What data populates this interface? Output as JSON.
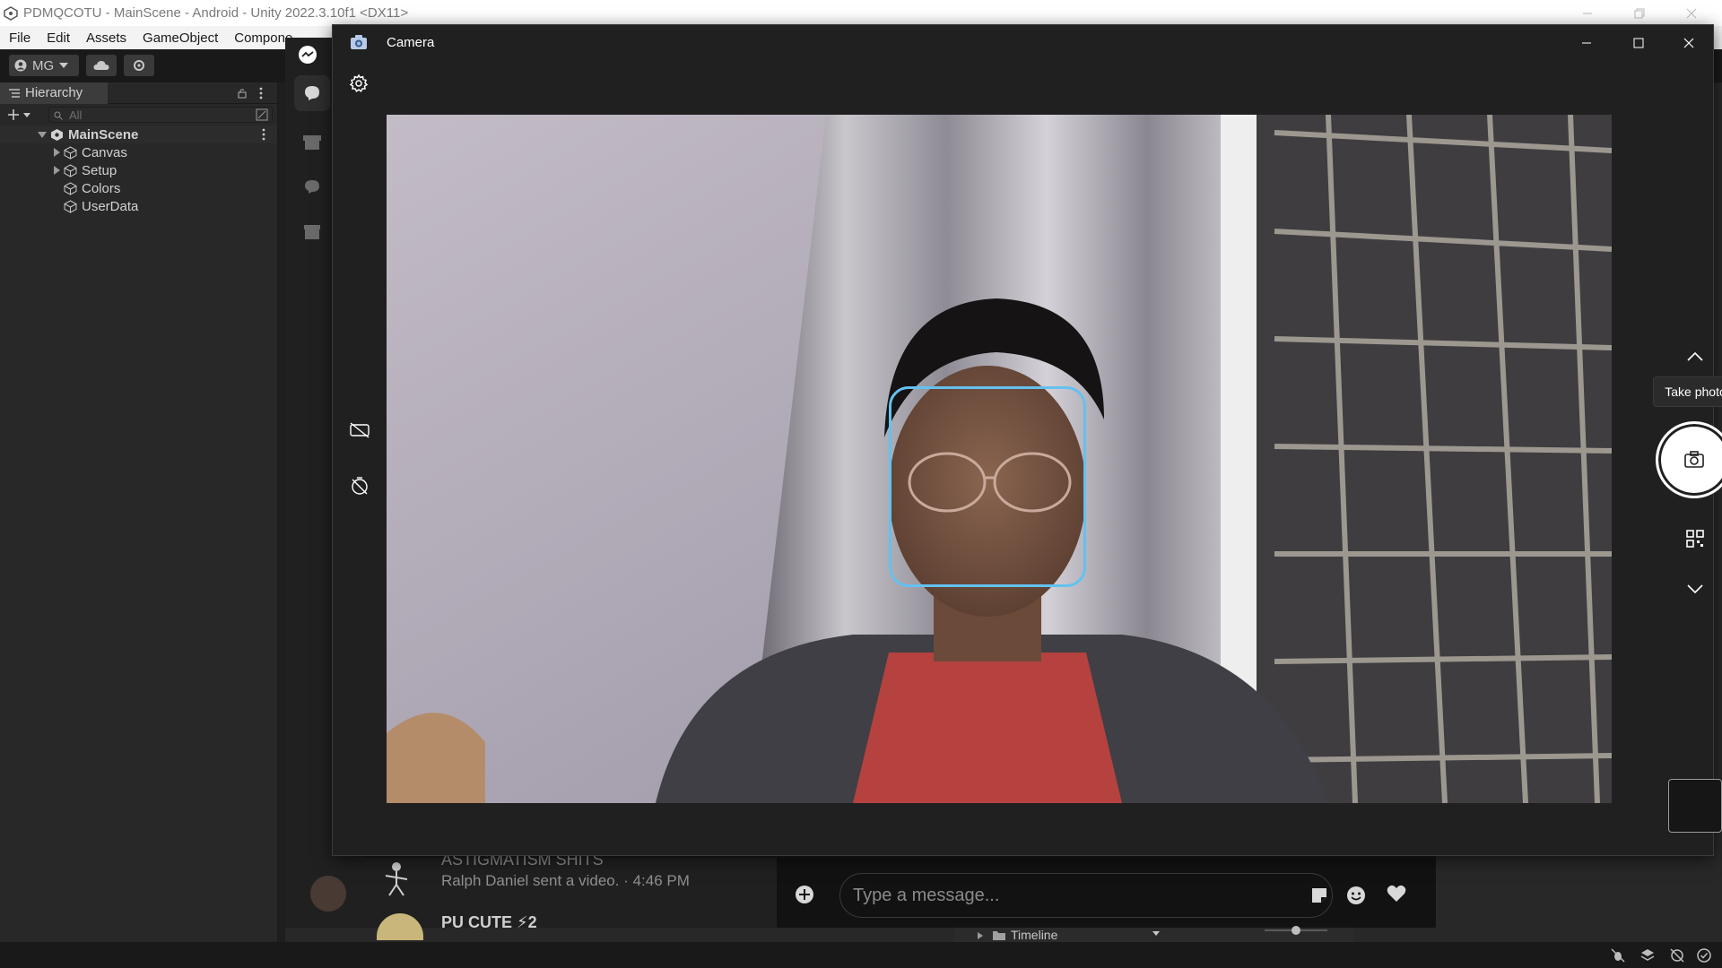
{
  "unity": {
    "window_title": "PDMQCOTU - MainScene - Android - Unity 2022.3.10f1 <DX11>",
    "menu": [
      "File",
      "Edit",
      "Assets",
      "GameObject",
      "Compone"
    ],
    "account_label": "MG",
    "hierarchy": {
      "tab_label": "Hierarchy",
      "search_placeholder": "All",
      "scene_name": "MainScene",
      "items": [
        {
          "label": "Canvas",
          "expandable": true
        },
        {
          "label": "Setup",
          "expandable": true
        },
        {
          "label": "Colors",
          "expandable": false
        },
        {
          "label": "UserData",
          "expandable": false
        }
      ]
    },
    "timeline_label": "Timeline"
  },
  "messenger": {
    "conversation_title": "ASTIGMATISM SHITS",
    "conversation_preview": "Ralph Daniel sent a video. · 4:46 PM",
    "next_conversation": "PU CUTE ⚡2",
    "message_placeholder": "Type a message..."
  },
  "camera": {
    "title": "Camera",
    "take_photo_label": "Take photo",
    "colors": {
      "face_box": "#63c1f0",
      "shutter": "#ffffff"
    }
  }
}
